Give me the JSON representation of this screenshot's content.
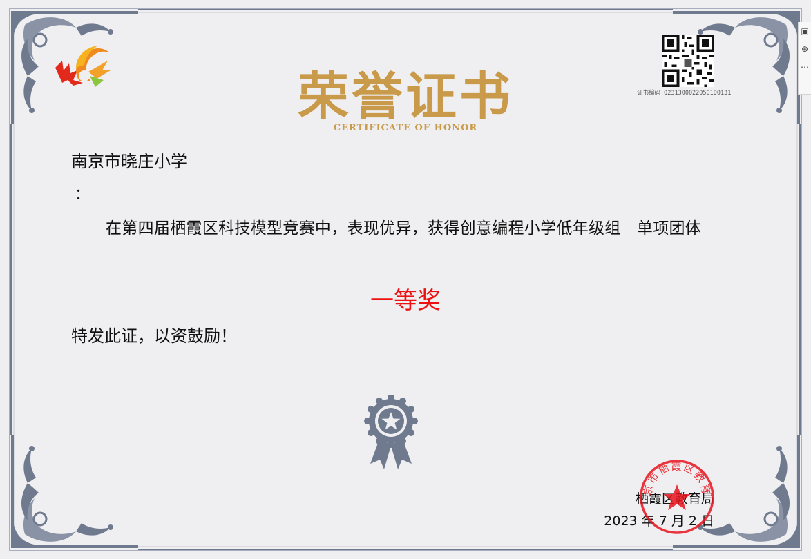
{
  "certificate": {
    "title": "荣誉证书",
    "subtitle": "CERTIFICATE OF HONOR",
    "cert_number": "证书编码:Q2313000220501D0131",
    "recipient": "南京市晓庄小学",
    "colon": "：",
    "body": "在第四届栖霞区科技模型竞赛中，表现优异，获得创意编程小学低年级组　单项团体",
    "award": "一等奖",
    "closing": "特发此证，以资鼓励！",
    "issuer": "栖霞区教育局",
    "date": "2023 年 7 月 2 日",
    "seal_text": "南京市栖霞区教育局"
  },
  "colors": {
    "title_gold": "#c99a4a",
    "award_red": "#ee1111",
    "border_gray": "#6f7a8f",
    "seal_red": "#e8141e",
    "paper": "#efeff1"
  },
  "icons": {
    "logo": "flame-swirl-logo",
    "medal": "star-rosette-medal-icon",
    "seal": "official-red-seal",
    "qr": "qr-code",
    "side_tools": [
      "image-icon",
      "zoom-icon",
      "more-icon"
    ]
  }
}
